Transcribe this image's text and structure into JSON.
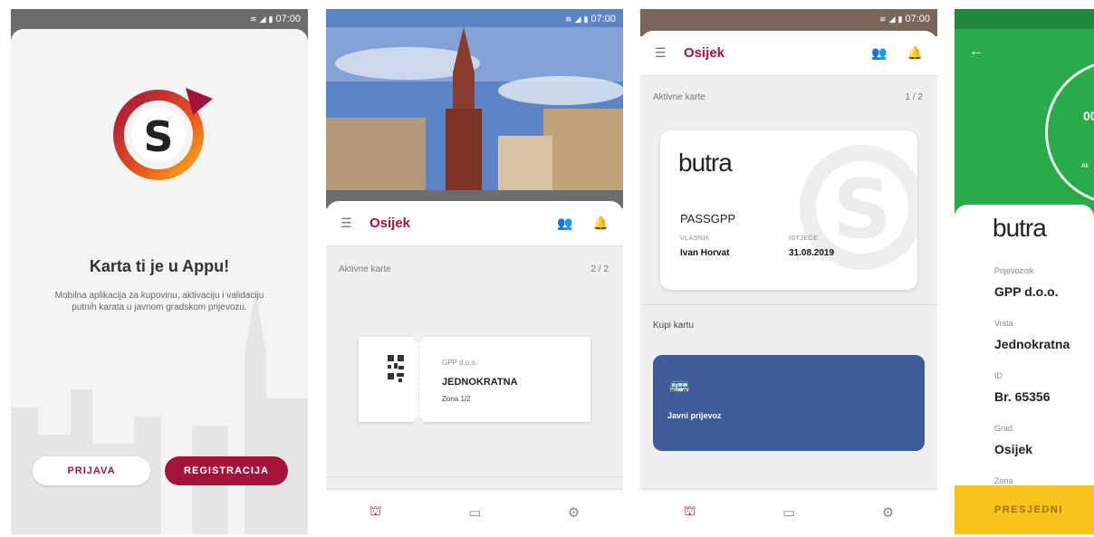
{
  "status_time": "07:00",
  "screen1": {
    "headline": "Karta ti je u Appu!",
    "subtext": "Mobilna aplikacija za kupovinu, aktivaciju i validaciju putnih karata u javnom gradskom prijevozu.",
    "login_label": "PRIJAVA",
    "register_label": "REGISTRACIJA"
  },
  "screen2": {
    "city": "Osijek",
    "active_label": "Aktivne karte",
    "active_count": "2 / 2",
    "ticket": {
      "company": "GPP d.o.o.",
      "type": "JEDNOKRATNA",
      "zone": "Zona 1/2"
    }
  },
  "screen3": {
    "city": "Osijek",
    "active_label": "Aktivne karte",
    "active_count": "1 / 2",
    "pass": {
      "brand": "butra",
      "name": "PASSGPP",
      "owner_label": "VLASNIK",
      "owner": "Ivan Horvat",
      "expires_label": "ISTJEČE",
      "expires": "31.08.2019"
    },
    "buy_label": "Kupi kartu",
    "transport_label": "Javni prijevoz"
  },
  "screen4": {
    "timer": "00:",
    "timer_sub": "Ak",
    "brand": "butra",
    "carrier_label": "Prijevoznik",
    "carrier": "GPP d.o.o.",
    "type_label": "Vrsta",
    "type": "Jednokratna",
    "id_label": "ID",
    "id": "Br. 65356",
    "city_label": "Grad",
    "city": "Osijek",
    "zone_label": "Zona",
    "transfer_label": "PRESJEDNI"
  },
  "colors": {
    "brand": "#a3143c",
    "transport": "#3e5b9a",
    "green": "#2aaa4a",
    "yellow": "#f8c21c"
  }
}
